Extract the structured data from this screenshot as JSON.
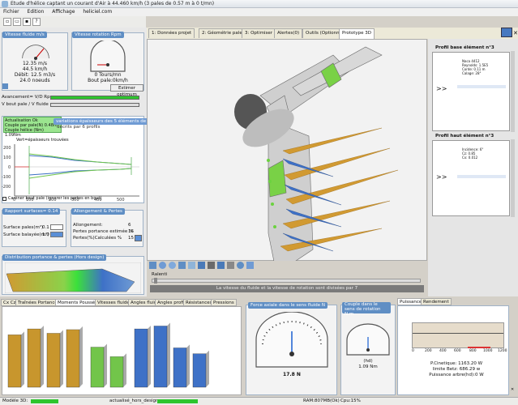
{
  "window": {
    "title": "Etude d'hélice captant un courant d'Air à 44.460 km/h (3 pales de 0.57 m à 0 t/mn)"
  },
  "menu": {
    "items": [
      "Fichier",
      "Edition",
      "Affichage",
      "heliciel.com"
    ]
  },
  "left": {
    "wind_panel_title": "Vitesse fluide m/s",
    "wind_values": [
      "12.35 m/s",
      "44.5 km/h",
      "Débit: 12.5 m3/s",
      "24.0 noeuds"
    ],
    "rot_panel_title": "Vitesse rotation Rpm",
    "rot_values": [
      "0 Tours/mn",
      "Bout pale:0km/h"
    ],
    "estimate_button": "Estimer optimum",
    "adv_label": "Avancement= V/D Rps",
    "ratio_label": "V bout pale / V fluide =",
    "status_msgs": [
      "Actualisation Ok",
      "Couple par pale(N) 0.48m",
      "Couple hélice (Nm) 1.09Nm"
    ],
    "chart_title": "variations épaisseurs des 5 éléments de la pale",
    "chart_note": "décrits par 6 profils",
    "chart_legend": "Vert=épaisseurs trouvées",
    "checkbox_label": "Caréner bout pale (ignorer les pertes en bout)",
    "surfaces_title": "Rapport surfaces= 0.14",
    "surface_rows": [
      {
        "label": "Surface pales(m²)",
        "value": "0.1"
      },
      {
        "label": "Surface balayée(m²)",
        "value": "1.0"
      }
    ],
    "elong_title": "Allongement & Pertes",
    "elong_rows": [
      {
        "label": "Allongement:",
        "value": "6"
      },
      {
        "label": "Pertes portance estimée %",
        "value": "16"
      },
      {
        "label": "Pertes(%)Calculées %",
        "value": "15"
      }
    ],
    "distrib_title": "Distribution portance & pertes (Hors design)"
  },
  "tabs": [
    "1: Données projet",
    "2: Géométrie pale",
    "3: Optimiser",
    "Alertes(0)",
    "Outils (Optionnel)",
    "Prototype 3D"
  ],
  "viewer": {
    "slider_label": "Ralenti",
    "footer_msg": "La vitesse du fluide et la vitesse de rotation sont divisées par 7",
    "tools": [
      "select-icon",
      "zoom-icon",
      "rotate-icon",
      "pan-icon",
      "grid-icon",
      "camera-icon",
      "print-icon",
      "palette-icon",
      "pencil-icon",
      "gear-icon",
      "axes-icon"
    ]
  },
  "right": {
    "profile1_title": "Profil base élément n°3",
    "profile2_title": "Profil haut élément n°3",
    "profile_lines": [
      "Naca 4412",
      "Reynolds: 1.5E5",
      "Corde: 0.11 m",
      "Calage: 28°",
      "Incidence: 6°",
      "Cz: 0.85",
      "Cx: 0.012"
    ]
  },
  "bottom_tabs": [
    "Cx Cz",
    "Traînées Portances",
    "Moments Poussées",
    "Vitesses fluide",
    "Angles fluide",
    "Angles profils",
    "Résistances",
    "Pressions"
  ],
  "bar_chart": {
    "series": [
      {
        "color": "#c8962d",
        "values": [
          0.72,
          0.8,
          0.74,
          0.79
        ]
      },
      {
        "color": "#72c54a",
        "values": [
          0.55,
          0.42
        ]
      },
      {
        "color": "#3e71c7",
        "values": [
          0.8,
          0.84,
          0.54,
          0.46
        ]
      }
    ]
  },
  "force_panel": {
    "title": "Force axiale dans le sens fluide N",
    "value": "17.8 N"
  },
  "torque_panel": {
    "title": "Couple dans le sens de rotation N.m",
    "value": "1.09 Nm",
    "unit": "(hd)"
  },
  "power_tabs": [
    "Puissance",
    "Rendement"
  ],
  "power": {
    "lines": [
      "P.Cinetique: 1163.20 W",
      "limite Betz: 686.29 w",
      "Puissance arbre(hd):0 W"
    ],
    "axis": [
      "0",
      "200",
      "400",
      "600",
      "800",
      "1000",
      "1200"
    ]
  },
  "status": {
    "model": "Modèle 3D:",
    "actualise": "actualisé_hors_design",
    "ram": "RAM:807MB(Ok)",
    "cpu": "Cpu:15%"
  }
}
